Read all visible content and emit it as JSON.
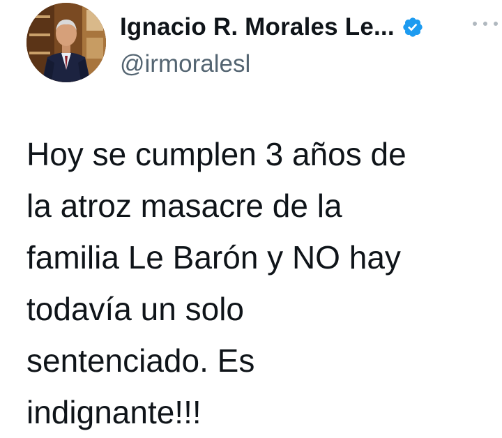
{
  "author": {
    "display_name": "Ignacio R. Morales Le...",
    "handle": "@irmoralesl",
    "verified_icon": "verified-badge-icon",
    "avatar_icon": "profile-photo"
  },
  "menu": {
    "icon": "more-options-icon"
  },
  "tweet": {
    "lines": [
      "Hoy se cumplen 3 años de",
      "la atroz masacre de la",
      "familia Le Barón y NO hay",
      "todavía un solo",
      "sentenciado. Es",
      "indignante!!!"
    ]
  },
  "colors": {
    "text": "#0f1419",
    "secondary": "#536471",
    "verified": "#1d9bf0"
  }
}
